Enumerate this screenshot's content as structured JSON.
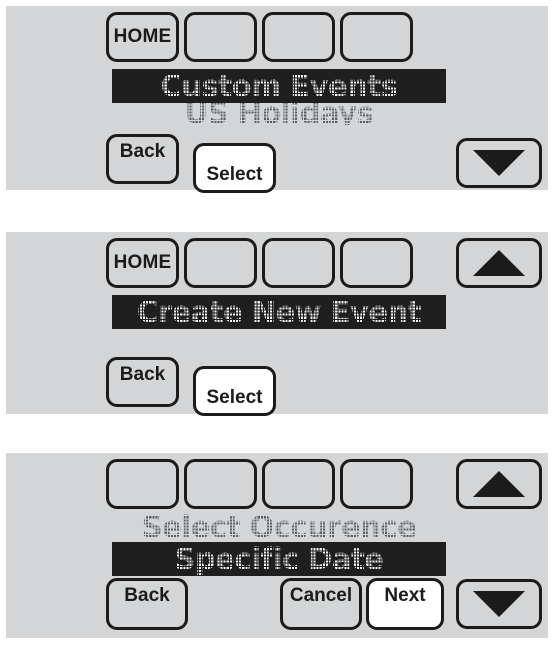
{
  "document": {
    "title": "Thermostat Custom Events screen sequence",
    "background_color": "#ffffff",
    "screen_color": "#d3d5d6",
    "ink_color": "#1b1b1b",
    "lcd_highlight_bg": "#1f1f1f",
    "lcd_highlight_fg": "#f2f2f2",
    "lcd_plain_fg": "#5a5c5e"
  },
  "panels": [
    {
      "id": "panel-1",
      "name": "custom-events-screen",
      "softkeys": [
        {
          "label": "HOME",
          "blank": false
        },
        {
          "label": "",
          "blank": true
        },
        {
          "label": "",
          "blank": true
        },
        {
          "label": "",
          "blank": true
        }
      ],
      "lcd": {
        "line1": "Custom Events",
        "line1_style": "highlight",
        "line2": "US Holidays",
        "line2_style": "plain-clipped"
      },
      "bottom_buttons": [
        {
          "label": "Back",
          "style": "gray",
          "text_align": "top"
        },
        {
          "label": "Select",
          "style": "white",
          "text_align": "bottom"
        }
      ],
      "arrow": {
        "direction": "down",
        "icon": "triangle-down-icon"
      }
    },
    {
      "id": "panel-2",
      "name": "create-new-event-screen",
      "softkeys": [
        {
          "label": "HOME",
          "blank": false
        },
        {
          "label": "",
          "blank": true
        },
        {
          "label": "",
          "blank": true
        },
        {
          "label": "",
          "blank": true
        }
      ],
      "lcd": {
        "line1": "Create New Event",
        "line1_style": "highlight",
        "line2": "",
        "line2_style": "none"
      },
      "bottom_buttons": [
        {
          "label": "Back",
          "style": "gray",
          "text_align": "top"
        },
        {
          "label": "Select",
          "style": "white",
          "text_align": "bottom"
        }
      ],
      "arrow": {
        "direction": "up",
        "icon": "triangle-up-icon"
      }
    },
    {
      "id": "panel-3",
      "name": "select-occurence-screen",
      "softkeys": [
        {
          "label": "",
          "blank": true
        },
        {
          "label": "",
          "blank": true
        },
        {
          "label": "",
          "blank": true
        },
        {
          "label": "",
          "blank": true
        }
      ],
      "lcd": {
        "line1": "Select Occurence",
        "line1_style": "plain",
        "line2": "Specific Date",
        "line2_style": "highlight"
      },
      "bottom_buttons": [
        {
          "label": "Back",
          "style": "gray",
          "text_align": "top"
        },
        {
          "label": "Cancel",
          "style": "gray",
          "text_align": "top"
        },
        {
          "label": "Next",
          "style": "white",
          "text_align": "top"
        }
      ],
      "arrows": [
        {
          "direction": "up",
          "icon": "triangle-up-icon"
        },
        {
          "direction": "down",
          "icon": "triangle-down-icon"
        }
      ]
    }
  ]
}
